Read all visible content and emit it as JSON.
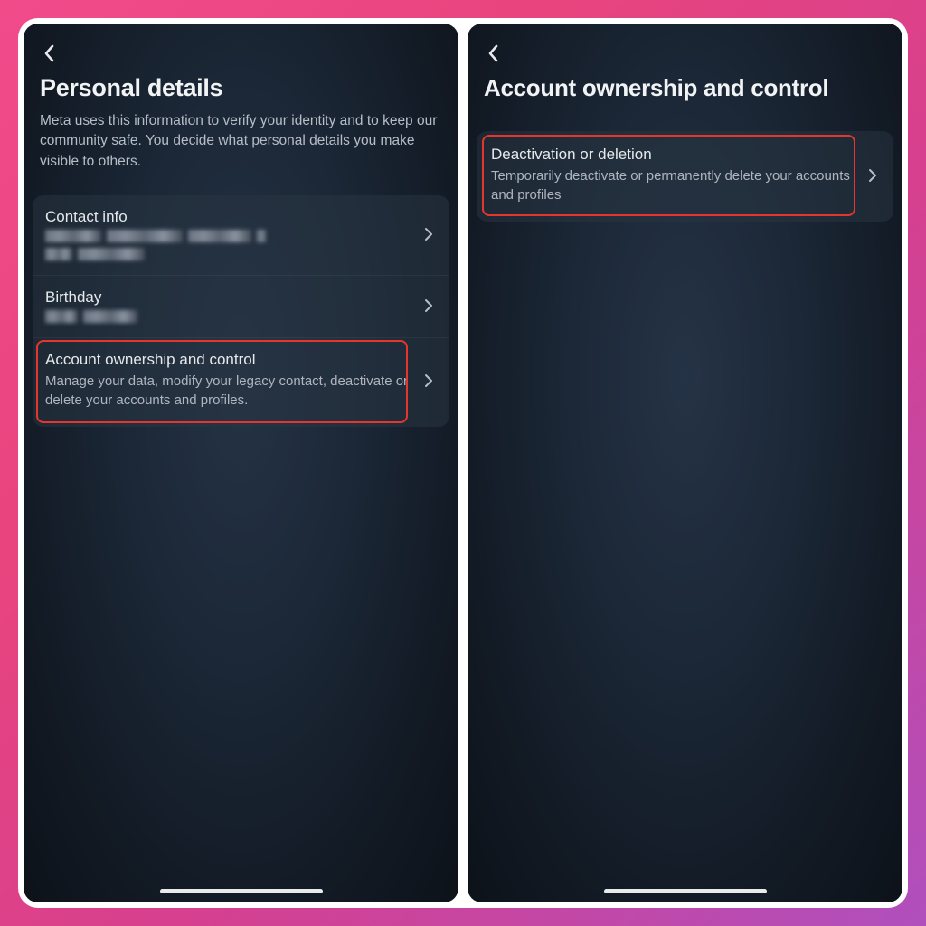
{
  "left": {
    "title": "Personal details",
    "subtitle": "Meta uses this information to verify your identity and to keep our community safe. You decide what personal details you make visible to others.",
    "rows": {
      "contact": {
        "title": "Contact info"
      },
      "birthday": {
        "title": "Birthday"
      },
      "ownership": {
        "title": "Account ownership and control",
        "sub": "Manage your data, modify your legacy contact, deactivate or delete your accounts and profiles."
      }
    }
  },
  "right": {
    "title": "Account ownership and control",
    "rows": {
      "deactivate": {
        "title": "Deactivation or deletion",
        "sub": "Temporarily deactivate or permanently delete your accounts and profiles"
      }
    }
  }
}
